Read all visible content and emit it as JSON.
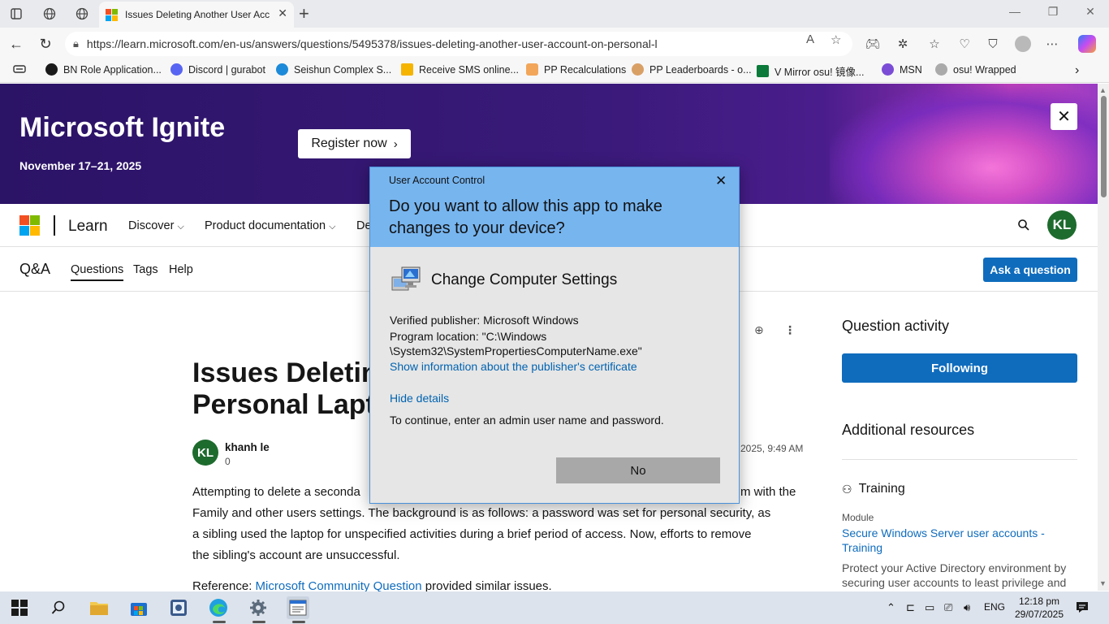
{
  "browser": {
    "tab_title": "Issues Deleting Another User Acc",
    "url": "https://learn.microsoft.com/en-us/answers/questions/5495378/issues-deleting-another-user-account-on-personal-l",
    "bookmarks": [
      {
        "label": "BN Role Application...",
        "color": "#1a1a1a"
      },
      {
        "label": "Discord | gurabot",
        "color": "#5865f2"
      },
      {
        "label": "Seishun Complex S...",
        "color": "#1c8ad8"
      },
      {
        "label": "Receive SMS online...",
        "color": "#f5b400"
      },
      {
        "label": "PP Recalculations",
        "color": "#f2a65a"
      },
      {
        "label": "PP Leaderboards - o...",
        "color": "#d9a066"
      },
      {
        "label": "V Mirror osu! 镜像...",
        "color": "#0b7a3a"
      },
      {
        "label": "MSN",
        "color": "#7b4dd6"
      },
      {
        "label": "osu! Wrapped",
        "color": "#aaaaaa"
      }
    ]
  },
  "banner": {
    "title": "Microsoft Ignite",
    "date": "November 17–21, 2025",
    "register_label": "Register now",
    "close_label": "✕"
  },
  "learn_nav": {
    "brand": "Learn",
    "items": [
      "Discover",
      "Product documentation",
      "De"
    ],
    "user_initials": "KL"
  },
  "qa_nav": {
    "title": "Q&A",
    "items": [
      "Questions",
      "Tags",
      "Help"
    ],
    "ask_label": "Ask a question"
  },
  "question": {
    "title_line1": "Issues Deleting",
    "title_line2": "Personal Lapto",
    "author_initials": "KL",
    "author_name": "khanh le",
    "author_rep": "0",
    "date": "2025, 9:49 AM",
    "body_line1_left": "Attempting to delete a seconda",
    "body_line1_right": "m with the",
    "body_line2": "Family and other users settings. The background is as follows: a password was set for personal security, as",
    "body_line3": "a sibling used the laptop for unspecified activities during a brief period of access. Now, efforts to remove",
    "body_line4": "the sibling's account are unsuccessful.",
    "ref_prefix": "Reference: ",
    "ref_link": "Microsoft Community Question",
    "ref_suffix": " provided similar issues."
  },
  "sidebar": {
    "activity_heading": "Question activity",
    "following_label": "Following",
    "resources_heading": "Additional resources",
    "training_heading": "Training",
    "module_label": "Module",
    "module_link": "Secure Windows Server user accounts - Training",
    "module_desc": "Protect your Active Directory environment by securing user accounts to least privilege and"
  },
  "uac": {
    "caption": "User Account Control",
    "question": "Do you want to allow this app to make changes to your device?",
    "app_name": "Change Computer Settings",
    "publisher": "Verified publisher: Microsoft Windows",
    "location_line1": "Program location: \"C:\\Windows",
    "location_line2": "\\System32\\SystemPropertiesComputerName.exe\"",
    "cert_link": "Show information about the publisher's certificate",
    "hide_details": "Hide details",
    "instruction": "To continue, enter an admin user name and password.",
    "no_label": "No",
    "header_color": "#77b5ef"
  },
  "taskbar": {
    "language": "ENG",
    "time": "12:18 pm",
    "date": "29/07/2025"
  }
}
